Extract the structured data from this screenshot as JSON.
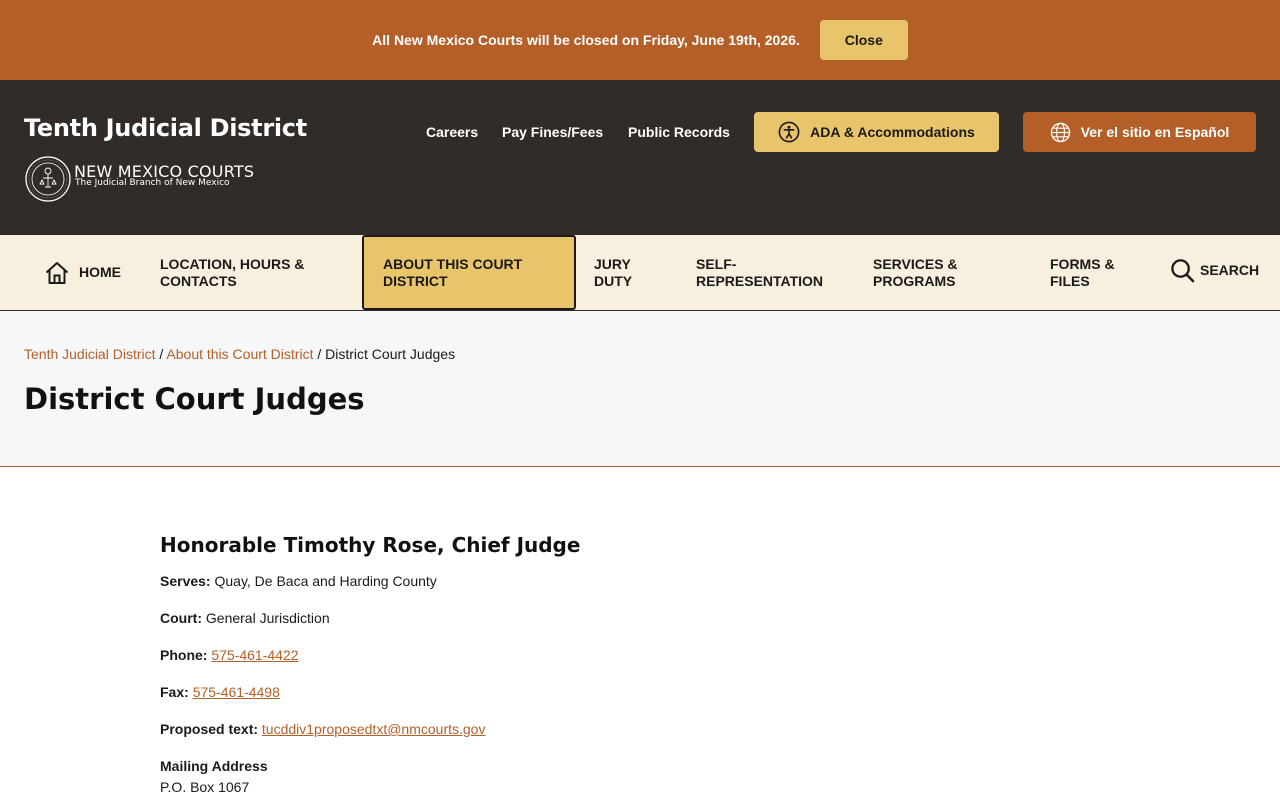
{
  "alert": {
    "message": "All New Mexico Courts will be closed on Friday, June 19th, 2026.",
    "close_label": "Close"
  },
  "header": {
    "site_title": "Tenth Judicial District",
    "logo_main": "NEW MEXICO COURTS",
    "logo_sub": "The Judicial Branch of New Mexico",
    "links": [
      {
        "label": "Careers"
      },
      {
        "label": "Pay Fines/Fees"
      },
      {
        "label": "Public Records"
      }
    ],
    "ada_label": "ADA & Accommodations",
    "spanish_label": "Ver el sitio en Español"
  },
  "nav": {
    "home": "HOME",
    "items": [
      {
        "label": "LOCATION, HOURS & CONTACTS"
      },
      {
        "label": "ABOUT THIS COURT DISTRICT"
      },
      {
        "label": "JURY DUTY"
      },
      {
        "label": "SELF-REPRESENTATION"
      },
      {
        "label": "SERVICES & PROGRAMS"
      },
      {
        "label": "FORMS & FILES"
      }
    ],
    "search": "SEARCH"
  },
  "breadcrumb": {
    "items": [
      {
        "label": "Tenth Judicial District"
      },
      {
        "label": "About this Court District"
      }
    ],
    "current": "District Court Judges",
    "separator": "/"
  },
  "page": {
    "title": "District Court Judges"
  },
  "judge": {
    "name": "Honorable Timothy Rose, Chief Judge",
    "serves_label": "Serves:",
    "serves": "Quay, De Baca and Harding County",
    "court_label": "Court:",
    "court": "General Jurisdiction",
    "phone_label": "Phone:",
    "phone": "575-461-4422",
    "fax_label": "Fax:",
    "fax": "575-461-4498",
    "proposed_label": "Proposed text:",
    "proposed_email": "tucddiv1proposedtxt@nmcourts.gov",
    "mailing_label": "Mailing Address",
    "mailing_line1": "P.O. Box 1067"
  },
  "colors": {
    "accent_orange": "#b45f28",
    "accent_gold": "#e8c46a",
    "header_dark": "#322c29",
    "nav_cream": "#f8f0de"
  },
  "icons": {
    "ada": "accessibility-icon",
    "spanish": "globe-icon",
    "home": "home-icon",
    "search": "search-icon",
    "seal": "court-seal-icon"
  }
}
